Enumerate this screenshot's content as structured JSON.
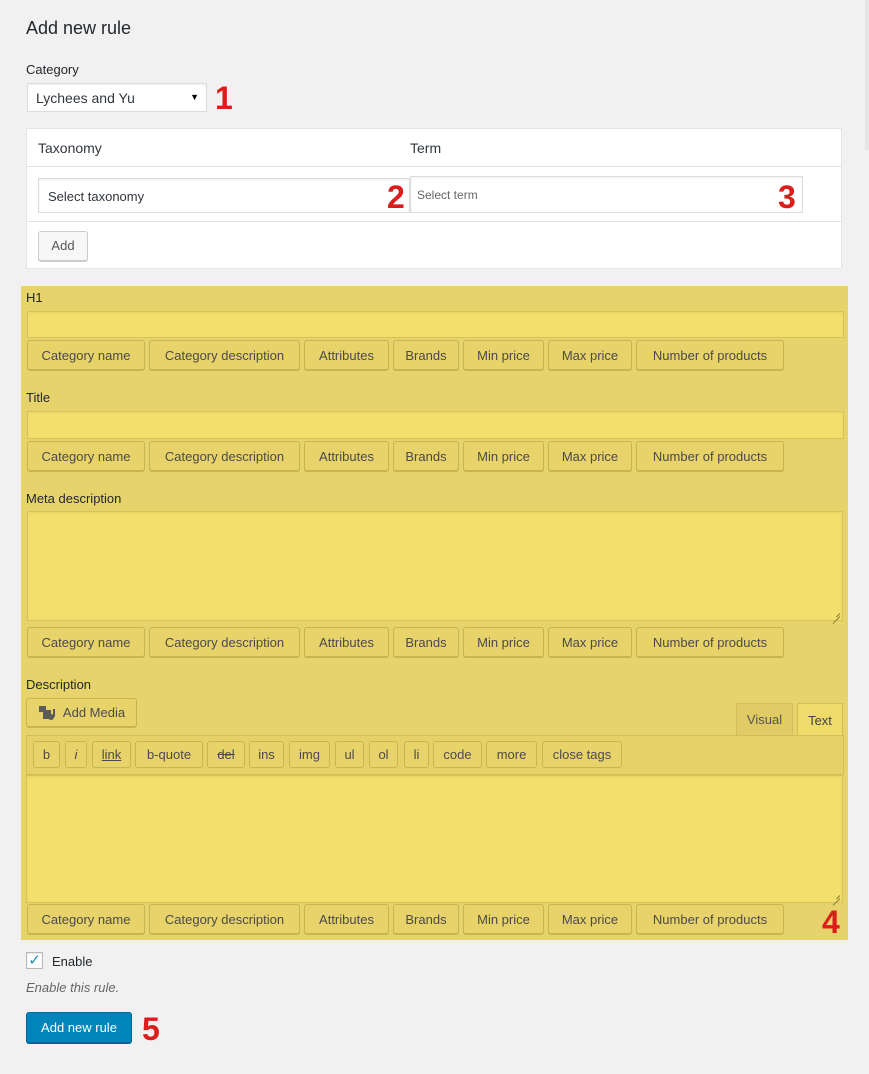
{
  "page": {
    "title": "Add new rule"
  },
  "category": {
    "label": "Category",
    "selected": "Lychees and Yu"
  },
  "taxonomy_table": {
    "col_taxonomy": "Taxonomy",
    "col_term": "Term",
    "taxonomy_placeholder": "Select taxonomy",
    "term_placeholder": "Select term",
    "add_label": "Add"
  },
  "variable_buttons": [
    "Category name",
    "Category description",
    "Attributes",
    "Brands",
    "Min price",
    "Max price",
    "Number of products"
  ],
  "fields": {
    "h1_label": "H1",
    "title_label": "Title",
    "meta_label": "Meta description",
    "description_label": "Description"
  },
  "editor": {
    "add_media": "Add Media",
    "tab_visual": "Visual",
    "tab_text": "Text",
    "quicktags": [
      "b",
      "i",
      "link",
      "b-quote",
      "del",
      "ins",
      "img",
      "ul",
      "ol",
      "li",
      "code",
      "more",
      "close tags"
    ]
  },
  "enable": {
    "label": "Enable",
    "checked": true,
    "help": "Enable this rule."
  },
  "submit": {
    "label": "Add new rule"
  },
  "annotations": [
    "1",
    "2",
    "3",
    "4",
    "5"
  ],
  "colors": {
    "highlight": "#e7d36b",
    "annotation": "#dd1c1c",
    "primary": "#0085ba"
  }
}
